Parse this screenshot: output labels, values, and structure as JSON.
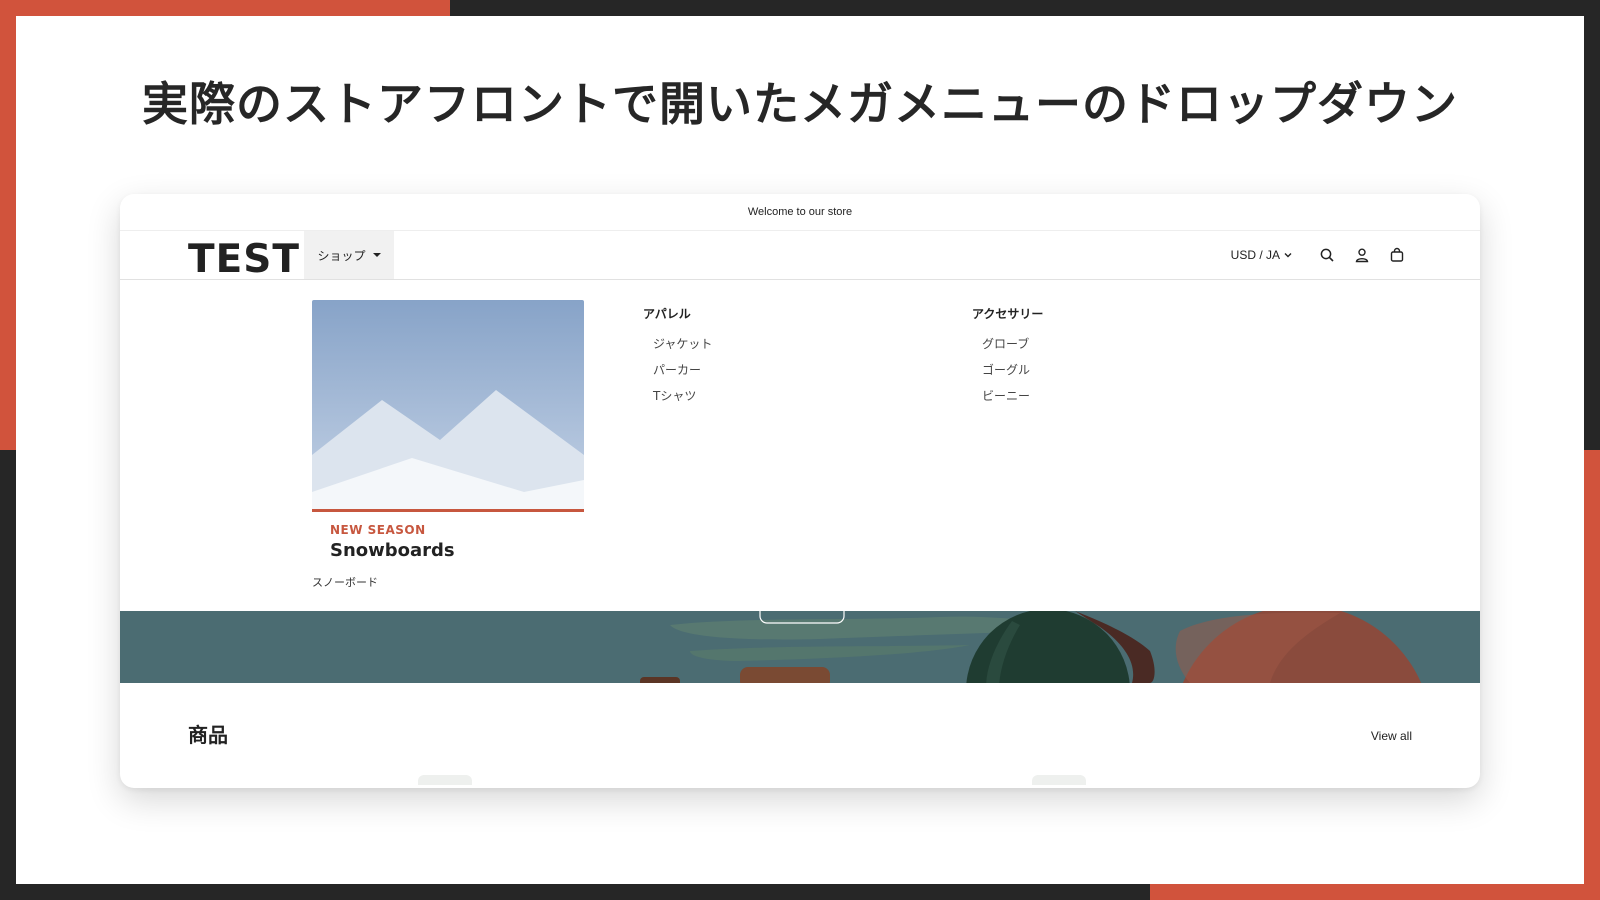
{
  "slide": {
    "title": "実際のストアフロントで開いたメガメニューのドロップダウン",
    "colors": {
      "accent": "#d1533c",
      "frame": "#262626",
      "background": "#ffffff"
    }
  },
  "store": {
    "announcement": "Welcome to our store",
    "logo": "TEST",
    "nav": {
      "shop_label": "ショップ"
    },
    "locale": "USD / JA",
    "icons": [
      "search-icon",
      "account-icon",
      "cart-icon"
    ]
  },
  "mega_menu": {
    "promo": {
      "eyebrow": "NEW SEASON",
      "title": "Snowboards",
      "link": "スノーボード"
    },
    "columns": [
      {
        "heading": "アパレル",
        "items": [
          "ジャケット",
          "パーカー",
          "Tシャツ"
        ]
      },
      {
        "heading": "アクセサリー",
        "items": [
          "グローブ",
          "ゴーグル",
          "ビーニー"
        ]
      }
    ]
  },
  "products": {
    "title": "商品",
    "view_all": "View all"
  }
}
